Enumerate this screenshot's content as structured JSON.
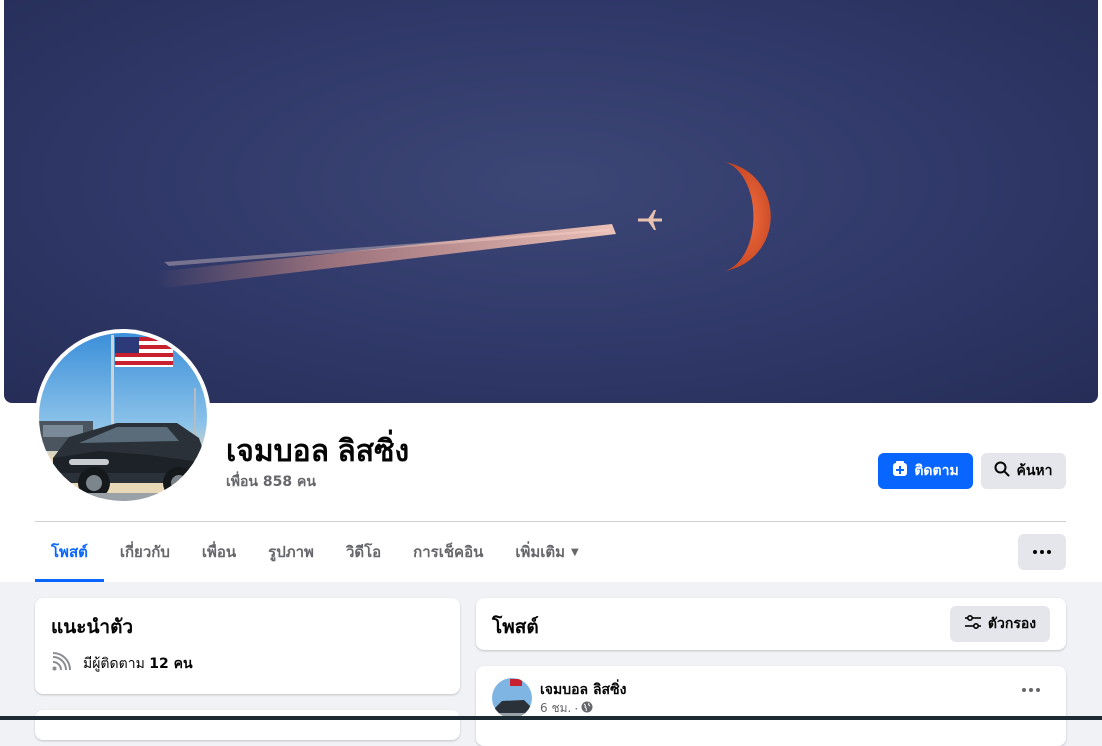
{
  "profile": {
    "name": "เจมบอล ลิสซิ่ง",
    "friends": "เพื่อน 858 คน"
  },
  "actions": {
    "follow_label": "ติดตาม",
    "search_label": "ค้นหา"
  },
  "tabs": [
    {
      "label": "โพสต์",
      "active": true
    },
    {
      "label": "เกี่ยวกับ",
      "active": false
    },
    {
      "label": "เพื่อน",
      "active": false
    },
    {
      "label": "รูปภาพ",
      "active": false
    },
    {
      "label": "วิดีโอ",
      "active": false
    },
    {
      "label": "การเช็คอิน",
      "active": false
    },
    {
      "label": "เพิ่มเติม",
      "active": false
    }
  ],
  "intro": {
    "title": "แนะนำตัว",
    "followers_prefix": "มีผู้ติดตาม",
    "followers_count": "12 คน"
  },
  "posts": {
    "title": "โพสต์",
    "filter_label": "ตัวกรอง"
  },
  "post": {
    "author": "เจมบอล ลิสซิ่ง",
    "time": "6 ชม.",
    "separator": "·"
  },
  "icons": {
    "follow": "follow-plus-icon",
    "search": "search-icon",
    "more": "more-dots-icon",
    "followers": "rss-icon",
    "filter": "filter-sliders-icon",
    "privacy": "globe-icon",
    "tab_more": "caret-down-icon"
  },
  "colors": {
    "accent": "#0866ff",
    "secondary_button": "#e4e6eb",
    "page_bg": "#f0f2f5",
    "muted_text": "#65676b"
  }
}
